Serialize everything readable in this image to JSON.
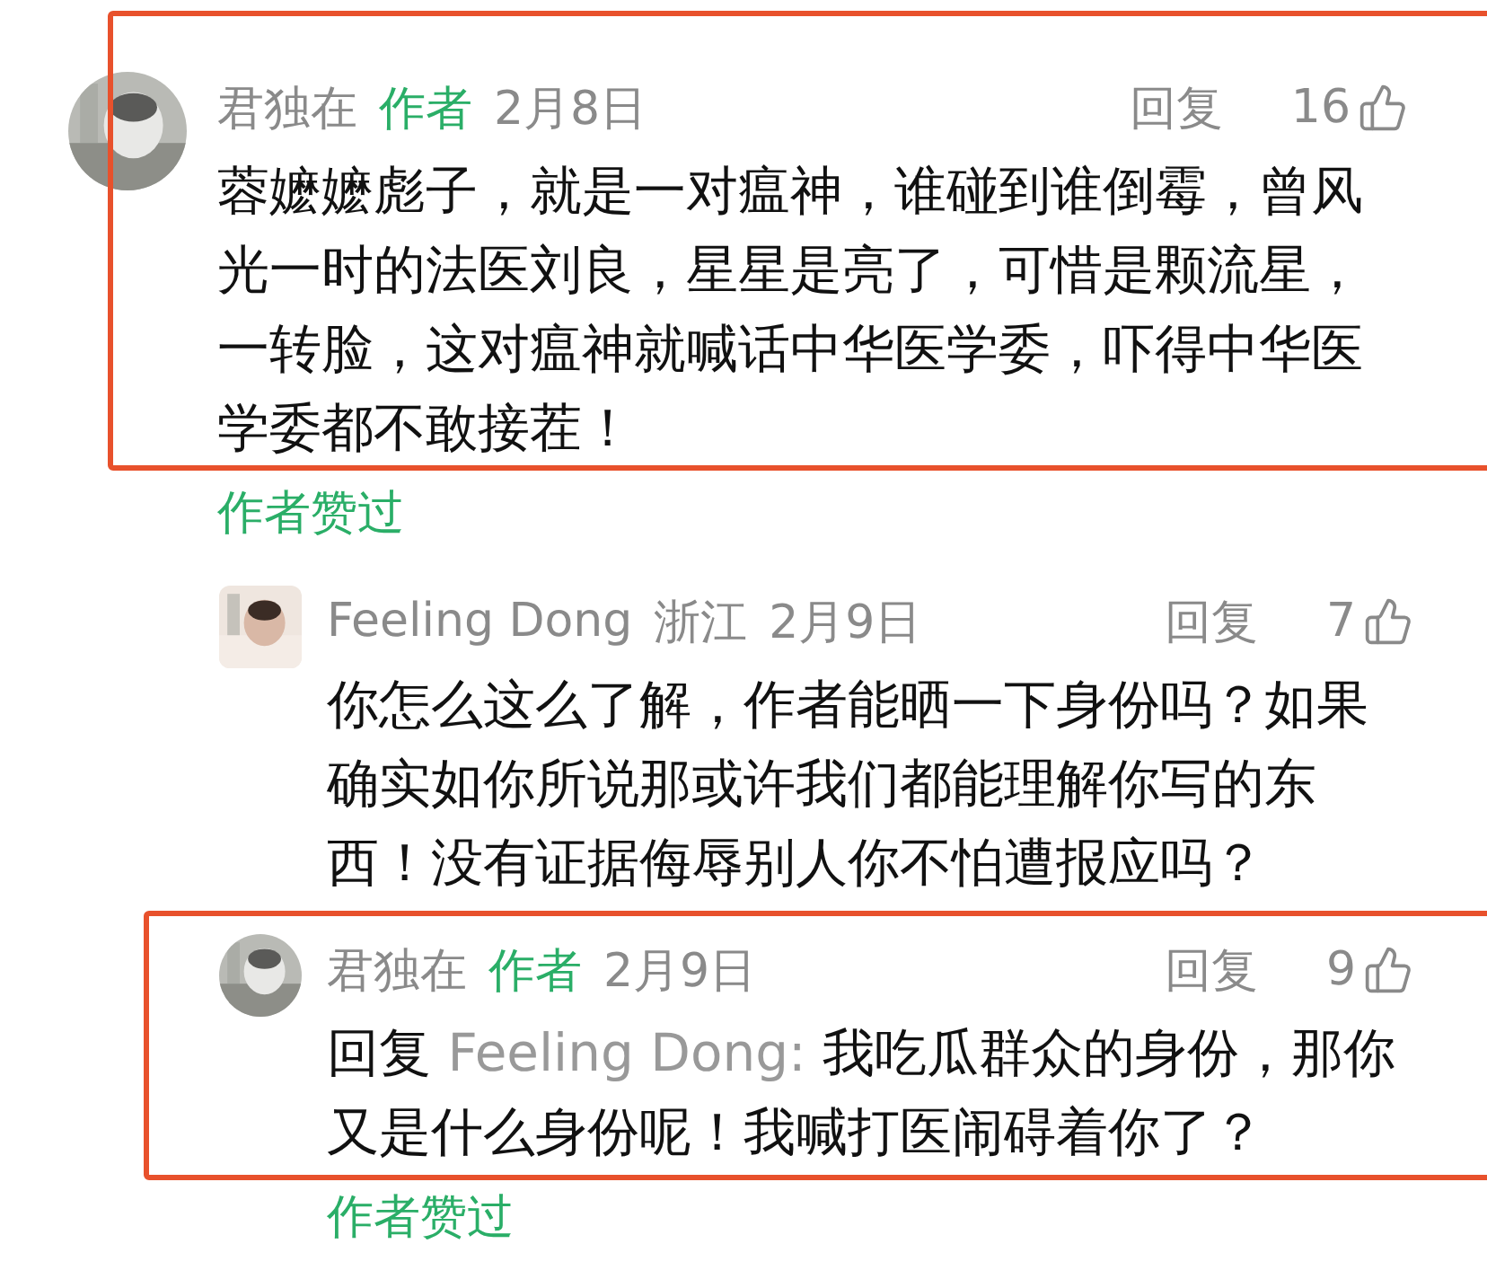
{
  "comments": [
    {
      "author": "君独在",
      "badge": "作者",
      "date": "2月8日",
      "reply_label": "回复",
      "likes": "16",
      "kind": "round",
      "highlighted": true,
      "text": "蓉嬷嬷彪子，就是一对瘟神，谁碰到谁倒霉，曾风光一时的法医刘良，星星是亮了，可惜是颗流星，一转脸，这对瘟神就喊话中华医学委，吓得中华医学委都不敢接茬！",
      "author_liked": "作者赞过",
      "replies": [
        {
          "author": "Feeling Dong",
          "location": "浙江",
          "date": "2月9日",
          "reply_label": "回复",
          "likes": "7",
          "kind": "square",
          "highlighted": false,
          "text": "你怎么这么了解，作者能晒一下身份吗？如果确实如你所说那或许我们都能理解你写的东西！没有证据侮辱别人你不怕遭报应吗？"
        },
        {
          "author": "君独在",
          "badge": "作者",
          "date": "2月9日",
          "reply_label": "回复",
          "likes": "9",
          "kind": "round",
          "highlighted": true,
          "reply_prefix": "回复",
          "reply_to": "Feeling Dong:",
          "text": "我吃瓜群众的身份，那你又是什么身份呢！我喊打医闹碍着你了？",
          "author_liked": "作者赞过"
        }
      ]
    }
  ]
}
